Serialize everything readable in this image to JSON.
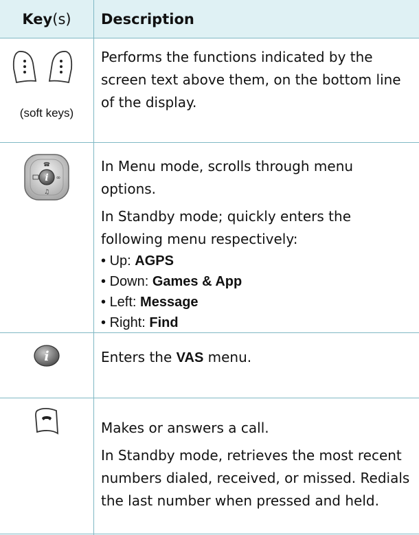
{
  "header": {
    "key_bold": "Key",
    "key_suffix": "(s)",
    "description": "Description"
  },
  "rows": [
    {
      "icon": "soft-keys-icon",
      "caption": "(soft keys)",
      "desc_lines": [
        "Performs the functions indicated by the screen text above them, on the bottom line of the display."
      ]
    },
    {
      "icon": "navigation-key-icon",
      "para1": "In Menu mode, scrolls through menu options.",
      "para2": "In Standby mode; quickly enters the following menu respectively:",
      "bullets": [
        {
          "label": "Up: ",
          "value": "AGPS"
        },
        {
          "label": "Down: ",
          "value": "Games & App"
        },
        {
          "label": "Left: ",
          "value": "Message"
        },
        {
          "label": "Right: ",
          "value": "Find"
        }
      ]
    },
    {
      "icon": "info-key-icon",
      "pre": "Enters the ",
      "bold": "VAS",
      "post": " menu."
    },
    {
      "icon": "send-key-icon",
      "para1": "Makes or answers a call.",
      "para2": "In Standby mode, retrieves the most recent numbers dialed, received, or missed. Redials the last number when pressed and held."
    }
  ],
  "colors": {
    "header_bg": "#dff1f4",
    "rule": "#7fb8c4"
  }
}
